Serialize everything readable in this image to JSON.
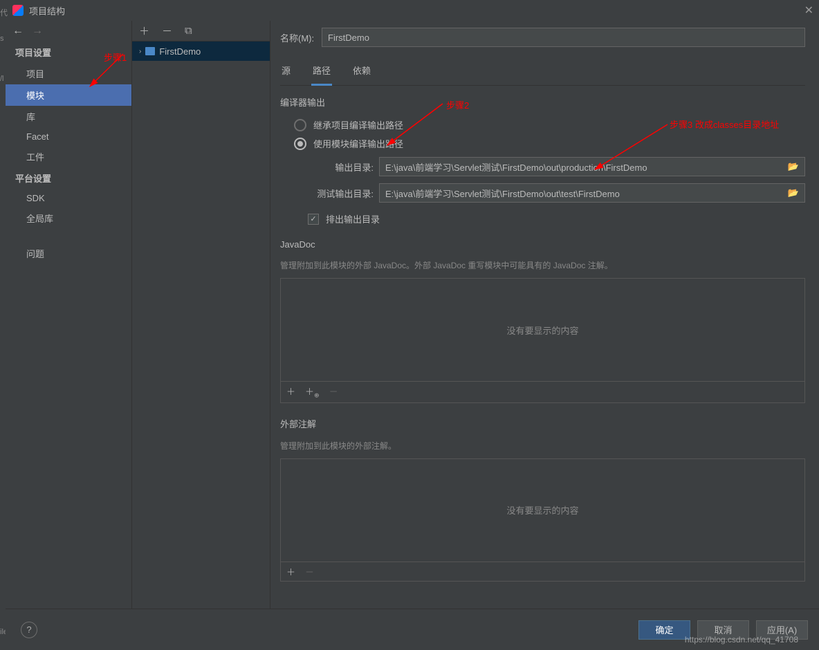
{
  "titlebar": {
    "left_char": "代",
    "title": "项目结构"
  },
  "side_letters": {
    "s": "s",
    "l": "/l",
    "ile": "ile"
  },
  "sidebar": {
    "nav_back": "←",
    "nav_fwd": "→",
    "section1": "项目设置",
    "items1": [
      "项目",
      "模块",
      "库",
      "Facet",
      "工件"
    ],
    "section2": "平台设置",
    "items2": [
      "SDK",
      "全局库"
    ],
    "problems": "问题"
  },
  "mid": {
    "plus": "＋",
    "minus": "－",
    "copy": "⧉",
    "chev": "›",
    "module": "FirstDemo"
  },
  "content": {
    "name_label": "名称(M):",
    "name_value": "FirstDemo",
    "tabs": [
      "源",
      "路径",
      "依赖"
    ],
    "compiler_output": "编译器输出",
    "radio_inherit": "继承项目编译输出路径",
    "radio_module": "使用模块编译输出路径",
    "output_label": "输出目录:",
    "output_value": "E:\\java\\前端学习\\Servlet测试\\FirstDemo\\out\\production\\FirstDemo",
    "test_output_label": "测试输出目录:",
    "test_output_value": "E:\\java\\前端学习\\Servlet测试\\FirstDemo\\out\\test\\FirstDemo",
    "exclude_label": "排出输出目录",
    "javadoc_title": "JavaDoc",
    "javadoc_desc": "管理附加到此模块的外部 JavaDoc。外部 JavaDoc 重写模块中可能具有的 JavaDoc 注解。",
    "empty_text": "没有要显示的内容",
    "ext_anno_title": "外部注解",
    "ext_anno_desc": "管理附加到此模块的外部注解。",
    "browse_icon": "📂"
  },
  "footer": {
    "ok": "确定",
    "cancel": "取消",
    "apply": "应用(A)"
  },
  "annotations": {
    "step1": "步骤1",
    "step2": "步骤2",
    "step3": "步骤3 改成classes目录地址"
  },
  "watermark": "https://blog.csdn.net/qq_41708"
}
